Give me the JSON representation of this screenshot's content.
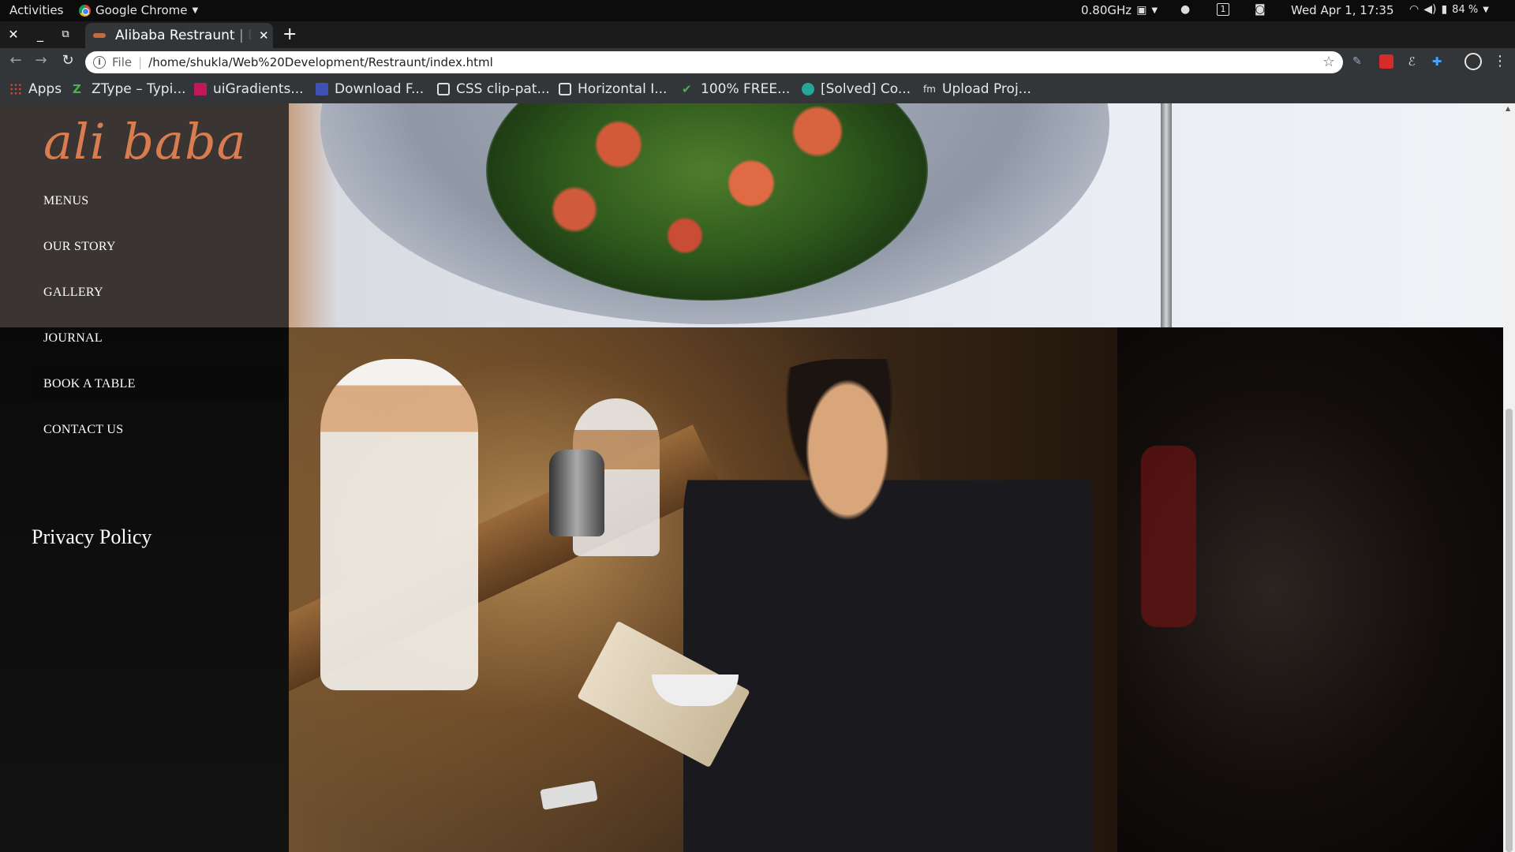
{
  "os_bar": {
    "activities": "Activities",
    "app_name": "Google Chrome",
    "cpu": "0.80GHz",
    "workspace": "1",
    "clock": "Wed Apr  1, 17:35",
    "battery": "84 %"
  },
  "browser": {
    "tab_title": "Alibaba Restraunt | Be",
    "url_scheme": "File",
    "url": "/home/shukla/Web%20Development/Restraunt/index.html",
    "bookmarks": [
      {
        "label": "Apps",
        "icon": "apps-grid-icon",
        "color": "#ea4335"
      },
      {
        "label": "ZType – Typi...",
        "icon": "ztype-icon",
        "color": "#4caf50"
      },
      {
        "label": "uiGradients...",
        "icon": "uigradients-icon",
        "color": "#c2185b"
      },
      {
        "label": "Download F...",
        "icon": "download-icon",
        "color": "#3f51b5"
      },
      {
        "label": "CSS clip-pat...",
        "icon": "clip-path-icon",
        "color": "#e0e0e0"
      },
      {
        "label": "Horizontal I...",
        "icon": "codepen-icon",
        "color": "#e0e0e0"
      },
      {
        "label": "100% FREE...",
        "icon": "free-icon",
        "color": "#4caf50"
      },
      {
        "label": "[Solved] Co...",
        "icon": "solved-icon",
        "color": "#26a69a"
      },
      {
        "label": "Upload Proj...",
        "icon": "upload-icon",
        "color": "#e0e0e0"
      }
    ]
  },
  "site": {
    "logo": "ali baba",
    "nav": [
      {
        "label": "MENUS",
        "active": false
      },
      {
        "label": "OUR STORY",
        "active": false
      },
      {
        "label": "GALLERY",
        "active": false
      },
      {
        "label": "JOURNAL",
        "active": false
      },
      {
        "label": "BOOK A TABLE",
        "active": true
      },
      {
        "label": "CONTACT US",
        "active": false
      }
    ],
    "privacy": "Privacy Policy",
    "accent_color": "#d97c4f"
  }
}
